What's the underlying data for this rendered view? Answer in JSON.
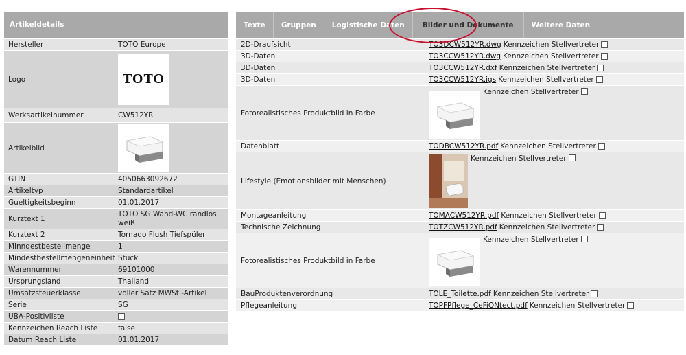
{
  "left": {
    "header": "Artikeldetails",
    "rows": [
      {
        "key": "Hersteller",
        "value": "TOTO Europe"
      },
      {
        "key": "Logo",
        "logo_text": "TOTO"
      },
      {
        "key": "Werksartikelnummer",
        "value": "CW512YR"
      },
      {
        "key": "Artikelbild"
      },
      {
        "key": "GTIN",
        "value": "4050663092672"
      },
      {
        "key": "Artikeltyp",
        "value": "Standardartikel"
      },
      {
        "key": "Gueltigkeitsbeginn",
        "value": "01.01.2017"
      },
      {
        "key": "Kurztext 1",
        "value": "TOTO SG Wand-WC randlos weiß"
      },
      {
        "key": "Kurztext 2",
        "value": "Tornado Flush Tiefspüler"
      },
      {
        "key": "Minndestbestellmenge",
        "value": "1"
      },
      {
        "key": "Mindestbestellmengeneinheit",
        "value": "Stück"
      },
      {
        "key": "Warennummer",
        "value": "69101000"
      },
      {
        "key": "Ursprungsland",
        "value": "Thailand"
      },
      {
        "key": "Umsatzsteuerklasse",
        "value": "voller Satz MWSt.-Artikel"
      },
      {
        "key": "Serie",
        "value": "SG"
      },
      {
        "key": "UBA-Positivliste"
      },
      {
        "key": "Kennzeichen Reach Liste",
        "value": "false"
      },
      {
        "key": "Datum Reach Liste",
        "value": "01.01.2017"
      }
    ]
  },
  "tabs": [
    "Texte",
    "Gruppen",
    "Logistische Daten",
    "Bilder und Dokumente",
    "Weitere Daten"
  ],
  "active_tab": "Bilder und Dokumente",
  "flag_label": "Kennzeichen Stellvertreter",
  "docs": [
    {
      "type": "2D-Draufsicht",
      "file": "TO3DCW512YR.dwg"
    },
    {
      "type": "3D-Daten",
      "file": "TO3CCW512YR.dwg"
    },
    {
      "type": "3D-Daten",
      "file": "TO3CCW512YR.dxf"
    },
    {
      "type": "3D-Daten",
      "file": "TO3CCW512YR.igs"
    },
    {
      "type": "Fotorealistisches Produktbild in Farbe"
    },
    {
      "type": "Datenblatt",
      "file": "TODBCW512YR.pdf"
    },
    {
      "type": "Lifestyle (Emotionsbilder mit Menschen)"
    },
    {
      "type": "Montageanleitung",
      "file": "TOMACW512YR.pdf"
    },
    {
      "type": "Technische Zeichnung",
      "file": "TOTZCW512YR.pdf"
    },
    {
      "type": "Fotorealistisches Produktbild in Farbe"
    },
    {
      "type": "BauProduktenverordnung",
      "file": "TOLE_Toilette.pdf"
    },
    {
      "type": "Pflegeanleitung",
      "file": "TOPFPflege_CeFiONtect.pdf"
    }
  ],
  "colors": {
    "header_bg": "#a9a9a9",
    "highlight": "#c8102e"
  }
}
